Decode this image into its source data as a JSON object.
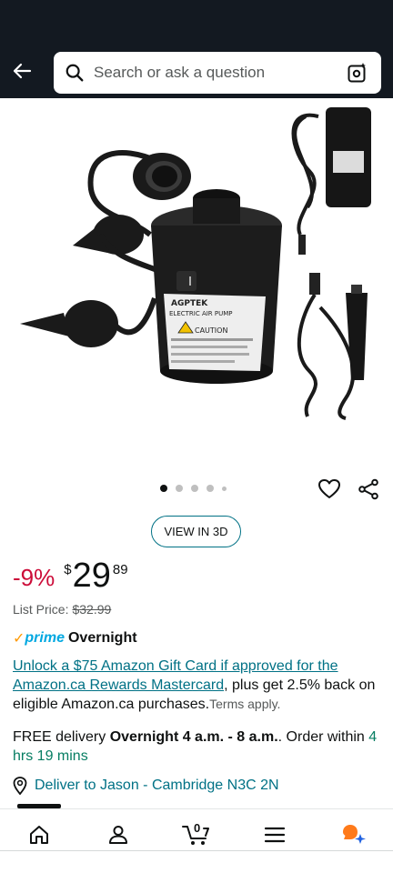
{
  "header": {
    "back_icon": "arrow-left-icon",
    "search_placeholder": "Search or ask a question",
    "search_icon": "magnifier-icon",
    "lens_icon": "camera-lens-icon"
  },
  "product_image": {
    "alt": "AGPTEK electric air pump with nozzles and adapters",
    "box_label_brand": "AGPTEK",
    "box_label_product": "ELECTRIC AIR PUMP",
    "caution_label": "CAUTION"
  },
  "carousel": {
    "total_dots": 5,
    "active_index": 0
  },
  "actions": {
    "wishlist_icon": "heart-icon",
    "share_icon": "share-icon",
    "view3d_label": "VIEW IN 3D"
  },
  "price": {
    "discount": "-9%",
    "currency_symbol": "$",
    "whole": "29",
    "fraction": "89",
    "list_price_label": "List Price:",
    "list_price_value": "$32.99"
  },
  "prime": {
    "check": "✓",
    "word": "prime",
    "label": "Overnight"
  },
  "promo": {
    "link_text": "Unlock a $75 Amazon Gift Card if approved for the Amazon.ca Rewards Mastercard",
    "body_text": ", plus get 2.5% back on eligible Amazon.ca purchases.",
    "terms_text": "Terms apply."
  },
  "delivery": {
    "prefix": "FREE delivery ",
    "window": "Overnight 4 a.m. - 8 a.m.",
    "middle": ". Order within ",
    "countdown": "4 hrs 19 mins"
  },
  "deliver_to": {
    "text": "Deliver to Jason - Cambridge N3C 2N",
    "icon": "location-pin-icon"
  },
  "bottom_nav": {
    "items": [
      {
        "name": "home",
        "icon": "home-icon"
      },
      {
        "name": "account",
        "icon": "person-icon"
      },
      {
        "name": "cart",
        "icon": "cart-icon",
        "count": "0"
      },
      {
        "name": "menu",
        "icon": "hamburger-icon"
      },
      {
        "name": "rufus",
        "icon": "assistant-icon"
      }
    ]
  },
  "colors": {
    "header_bg": "#131921",
    "discount": "#cc0c39",
    "link": "#007185",
    "prime": "#00a8e1",
    "prime_check": "#ff9900",
    "countdown": "#067d62"
  }
}
